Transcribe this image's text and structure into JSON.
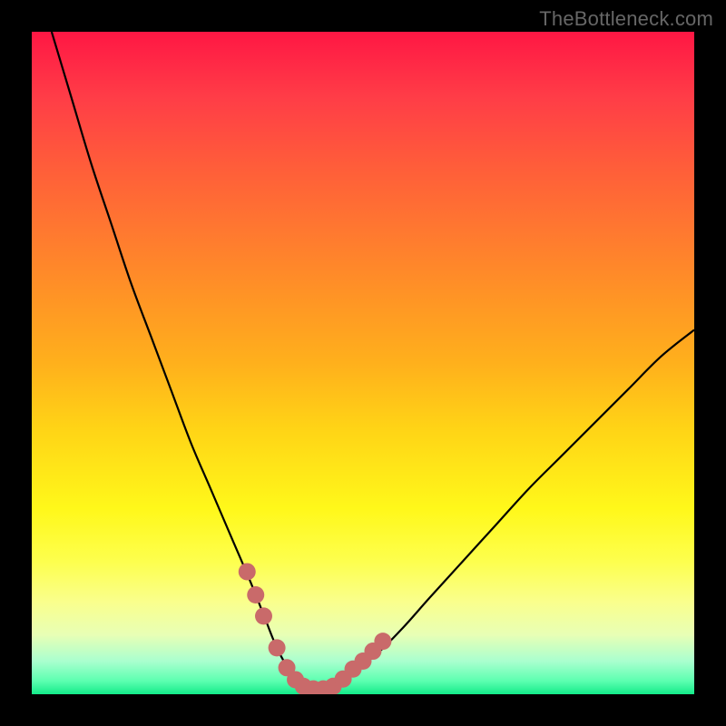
{
  "watermark": "TheBottleneck.com",
  "chart_data": {
    "type": "line",
    "title": "",
    "xlabel": "",
    "ylabel": "",
    "xlim": [
      0,
      100
    ],
    "ylim": [
      0,
      100
    ],
    "series": [
      {
        "name": "bottleneck-curve",
        "x": [
          3,
          6,
          9,
          12,
          15,
          18,
          21,
          24,
          27,
          30,
          33,
          35,
          37,
          39,
          41,
          43,
          45,
          48,
          52,
          56,
          60,
          65,
          70,
          75,
          80,
          85,
          90,
          95,
          100
        ],
        "values": [
          100,
          90,
          80,
          71,
          62,
          54,
          46,
          38,
          31,
          24,
          17,
          12,
          7,
          3.5,
          1.5,
          0.8,
          1.2,
          3,
          6,
          10,
          14.5,
          20,
          25.5,
          31,
          36,
          41,
          46,
          51,
          55
        ]
      }
    ],
    "markers": {
      "name": "highlight-dots",
      "color": "#c96a6a",
      "points": [
        {
          "x": 32.5,
          "y": 18.5
        },
        {
          "x": 33.8,
          "y": 15
        },
        {
          "x": 35,
          "y": 11.8
        },
        {
          "x": 37,
          "y": 7
        },
        {
          "x": 38.5,
          "y": 4
        },
        {
          "x": 39.8,
          "y": 2.2
        },
        {
          "x": 41,
          "y": 1.2
        },
        {
          "x": 42.5,
          "y": 0.8
        },
        {
          "x": 44,
          "y": 0.8
        },
        {
          "x": 45.5,
          "y": 1.2
        },
        {
          "x": 47,
          "y": 2.3
        },
        {
          "x": 48.5,
          "y": 3.8
        },
        {
          "x": 50,
          "y": 5
        },
        {
          "x": 51.5,
          "y": 6.5
        },
        {
          "x": 53,
          "y": 8
        }
      ]
    }
  }
}
